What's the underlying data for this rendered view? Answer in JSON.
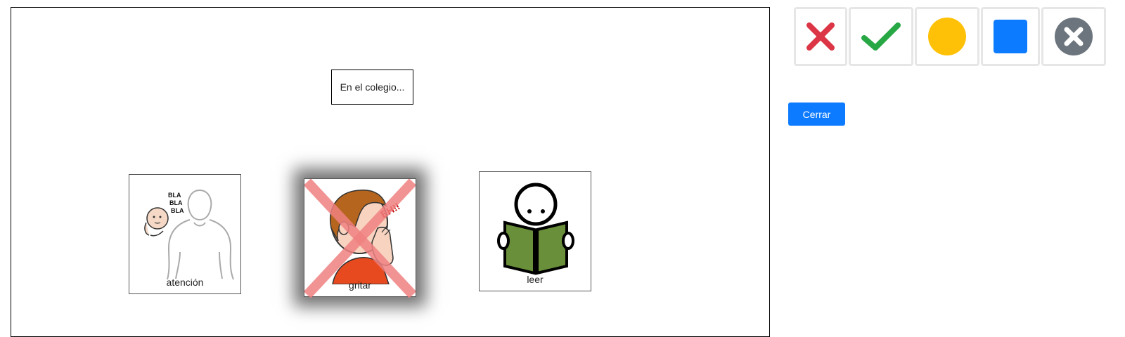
{
  "board": {
    "title": "En el colegio...",
    "cards": [
      {
        "label": "atención",
        "icon": "attention-pictogram",
        "crossed": false,
        "highlighted": false
      },
      {
        "label": "gritar",
        "icon": "shouting-pictogram",
        "crossed": true,
        "highlighted": true
      },
      {
        "label": "leer",
        "icon": "reading-pictogram",
        "crossed": false,
        "highlighted": false
      }
    ]
  },
  "toolbar": {
    "tools": [
      {
        "icon": "red-x-icon",
        "color": "#dc3545"
      },
      {
        "icon": "green-check-icon",
        "color": "#28a745"
      },
      {
        "icon": "yellow-circle-icon",
        "color": "#ffc107"
      },
      {
        "icon": "blue-square-icon",
        "color": "#0d7bff"
      },
      {
        "icon": "gray-close-circle-icon",
        "color": "#6c757d"
      }
    ]
  },
  "close_button": {
    "label": "Cerrar"
  },
  "pictogram_text": {
    "bla": "BLA",
    "eh": "EH!!"
  }
}
